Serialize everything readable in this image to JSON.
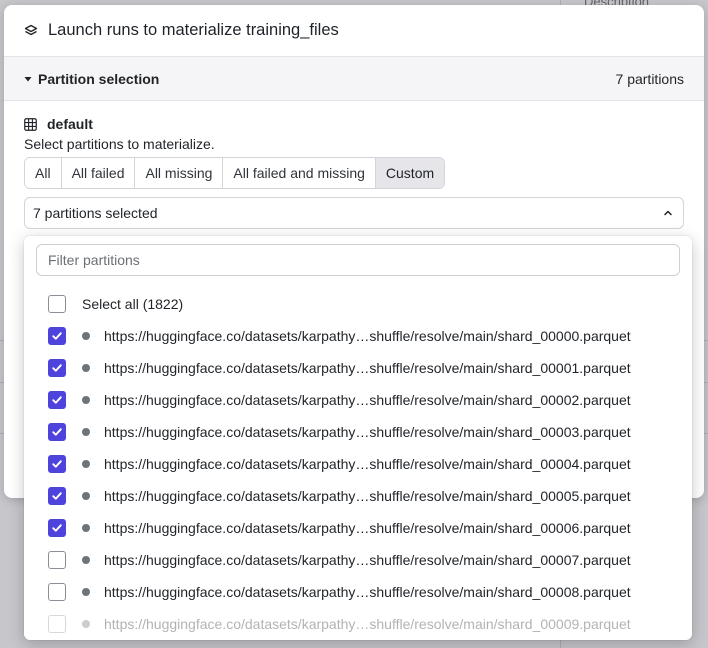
{
  "background": {
    "column_header": "Description"
  },
  "modal": {
    "title": "Launch runs to materialize training_files",
    "title_icon": "layers-icon",
    "section": {
      "title": "Partition selection",
      "count": "7 partitions",
      "caret_icon": "caret-down-icon"
    },
    "partition_set": {
      "label": "default",
      "icon": "grid-icon",
      "hint": "Select partitions to materialize."
    },
    "segments": [
      {
        "label": "All",
        "active": false
      },
      {
        "label": "All failed",
        "active": false
      },
      {
        "label": "All missing",
        "active": false
      },
      {
        "label": "All failed and missing",
        "active": false
      },
      {
        "label": "Custom",
        "active": true
      }
    ],
    "selector": {
      "value": "7 partitions selected",
      "icon": "chevron-up-icon"
    }
  },
  "dropdown": {
    "filter_placeholder": "Filter partitions",
    "select_all_label": "Select all (1822)",
    "items": [
      {
        "label": "https://huggingface.co/datasets/karpathy…shuffle/resolve/main/shard_00000.parquet",
        "checked": true
      },
      {
        "label": "https://huggingface.co/datasets/karpathy…shuffle/resolve/main/shard_00001.parquet",
        "checked": true
      },
      {
        "label": "https://huggingface.co/datasets/karpathy…shuffle/resolve/main/shard_00002.parquet",
        "checked": true
      },
      {
        "label": "https://huggingface.co/datasets/karpathy…shuffle/resolve/main/shard_00003.parquet",
        "checked": true
      },
      {
        "label": "https://huggingface.co/datasets/karpathy…shuffle/resolve/main/shard_00004.parquet",
        "checked": true
      },
      {
        "label": "https://huggingface.co/datasets/karpathy…shuffle/resolve/main/shard_00005.parquet",
        "checked": true
      },
      {
        "label": "https://huggingface.co/datasets/karpathy…shuffle/resolve/main/shard_00006.parquet",
        "checked": true
      },
      {
        "label": "https://huggingface.co/datasets/karpathy…shuffle/resolve/main/shard_00007.parquet",
        "checked": false
      },
      {
        "label": "https://huggingface.co/datasets/karpathy…shuffle/resolve/main/shard_00008.parquet",
        "checked": false
      },
      {
        "label": "https://huggingface.co/datasets/karpathy…shuffle/resolve/main/shard_00009.parquet",
        "checked": false
      }
    ]
  },
  "colors": {
    "checkbox_checked": "#4f43dd",
    "status_dot": "#6e7279",
    "segment_active_bg": "#e6e6ea"
  }
}
